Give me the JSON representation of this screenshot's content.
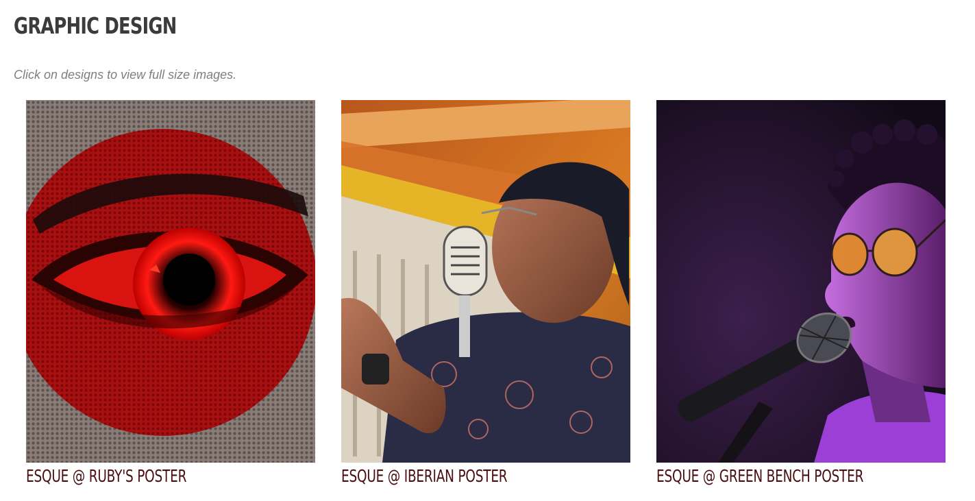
{
  "page": {
    "title": "GRAPHIC DESIGN",
    "subtitle": "Click on designs to view full size images."
  },
  "gallery": {
    "items": [
      {
        "caption": "ESQUE @ RUBY'S POSTER",
        "image": "eye-illustration-poster"
      },
      {
        "caption": "ESQUE @ IBERIAN POSTER",
        "image": "singer-with-vintage-microphone-poster"
      },
      {
        "caption": "ESQUE @ GREEN BENCH POSTER",
        "image": "singer-in-purple-light-poster"
      }
    ]
  },
  "colors": {
    "title": "#3a3b3c",
    "subtitle": "#7b7e84",
    "caption": "#4a0d10"
  }
}
